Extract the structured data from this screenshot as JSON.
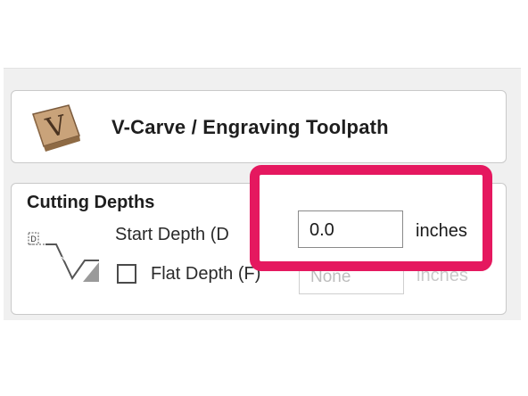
{
  "toolpath": {
    "icon": "v-carve-block-icon",
    "icon_letter": "V",
    "title": "V-Carve / Engraving Toolpath"
  },
  "cutting_depths": {
    "section_title": "Cutting Depths",
    "diagram_icon": "depth-profile-icon",
    "diagram_marker": "D",
    "start_depth": {
      "label": "Start Depth (D",
      "value": "0.0",
      "unit": "inches"
    },
    "flat_depth": {
      "label": "Flat Depth (F)",
      "checked": false,
      "value": "None",
      "unit": "inches"
    }
  },
  "colors": {
    "highlight": "#e5185f"
  }
}
